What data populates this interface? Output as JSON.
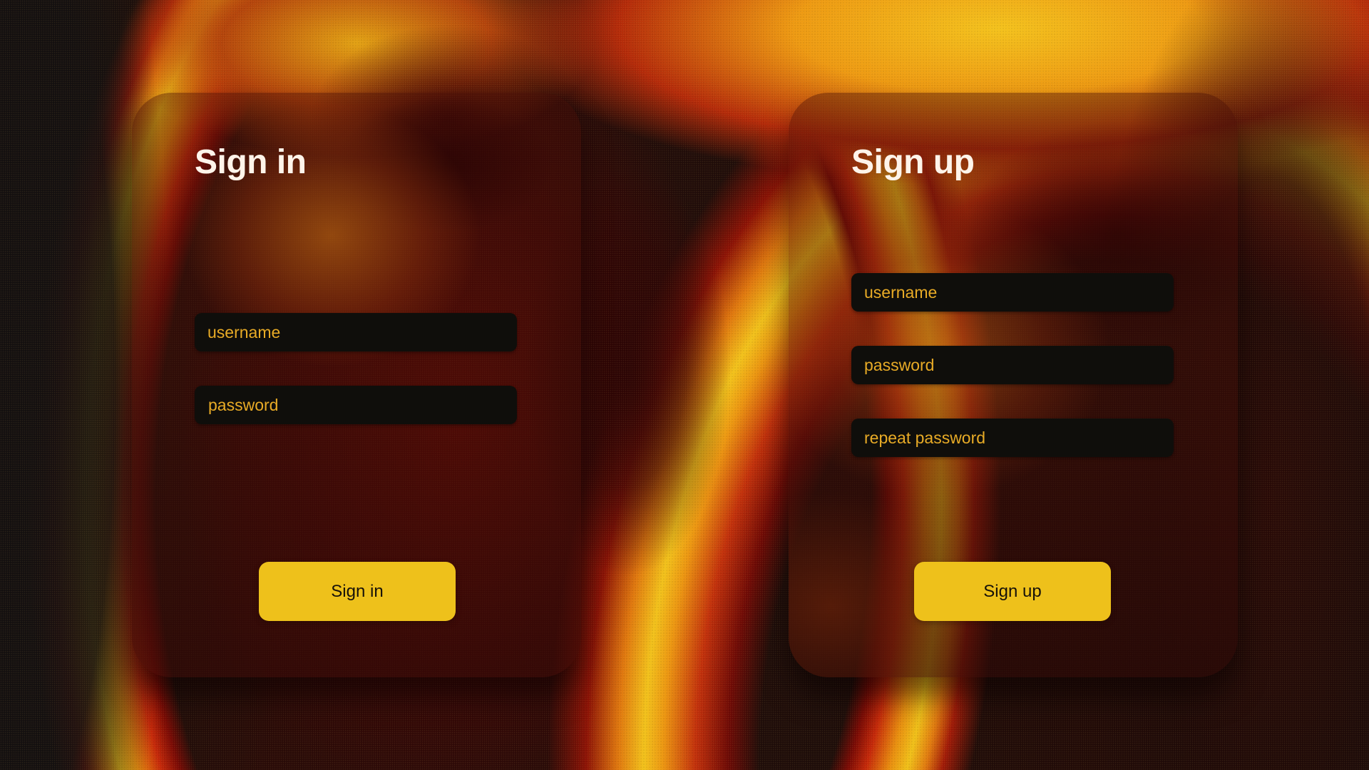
{
  "signin": {
    "title": "Sign in",
    "username_placeholder": "username",
    "password_placeholder": "password",
    "button_label": "Sign in"
  },
  "signup": {
    "title": "Sign up",
    "username_placeholder": "username",
    "password_placeholder": "password",
    "repeat_password_placeholder": "repeat password",
    "button_label": "Sign up"
  },
  "colors": {
    "accent": "#eec11b",
    "placeholder": "#e8ab26",
    "field_bg": "#0f0e0b",
    "title": "#fff4ea"
  }
}
